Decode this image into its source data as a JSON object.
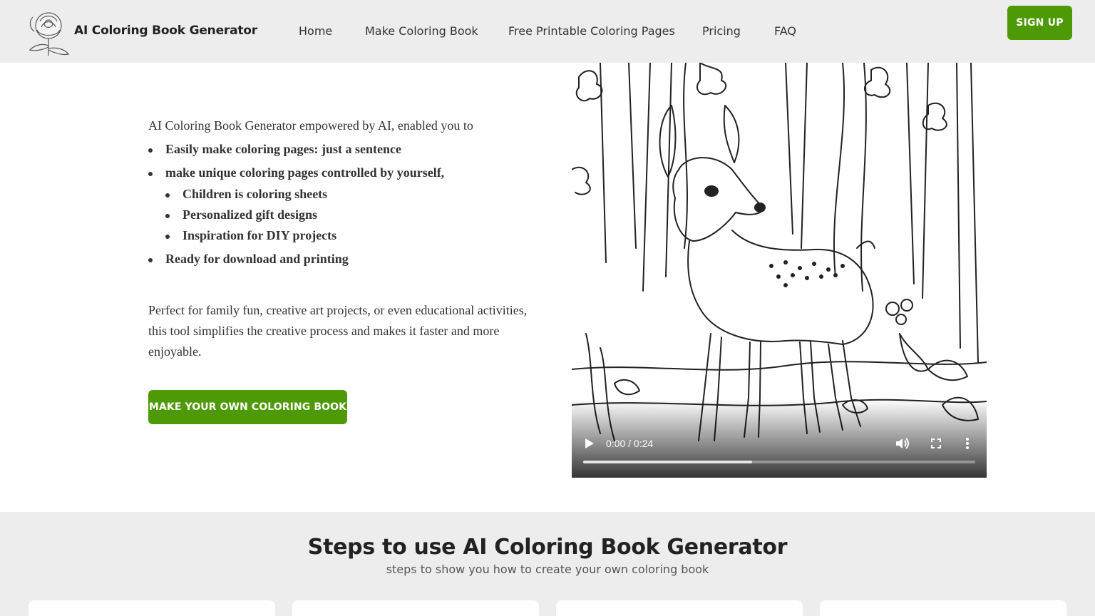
{
  "header": {
    "brand": "AI Coloring Book Generator",
    "logo_icon": "rose-logo-icon",
    "nav": [
      {
        "label": "Home"
      },
      {
        "label": "Make Coloring Book"
      },
      {
        "label": "Free Printable Coloring Pages"
      },
      {
        "label": "Pricing"
      },
      {
        "label": "FAQ"
      }
    ],
    "signup_label": "SIGN UP"
  },
  "hero": {
    "intro": "AI Coloring Book Generator empowered by AI, enabled you to",
    "features": [
      "Easily make coloring pages: just a sentence",
      "make unique coloring pages controlled by yourself,"
    ],
    "sub_features": [
      "Children is coloring sheets",
      "Personalized gift designs",
      "Inspiration for DIY projects"
    ],
    "last_feature": "Ready for download and printing",
    "description": "Perfect for family fun, creative art projects, or even educational activities, this tool simplifies the creative process and makes it faster and more enjoyable.",
    "cta_label": "MAKE YOUR OWN COLORING BOOK"
  },
  "video": {
    "time": "0:00 / 0:24",
    "buffered_fraction": 0.43,
    "controls": [
      "play-icon",
      "volume-icon",
      "fullscreen-icon",
      "more-options-icon"
    ]
  },
  "steps": {
    "title": "Steps to use AI Coloring Book Generator",
    "subtitle": "steps to show you how to create your own coloring book"
  },
  "colors": {
    "accent": "#4e9a06",
    "header_bg": "#ededed",
    "section_bg": "#ededed"
  }
}
